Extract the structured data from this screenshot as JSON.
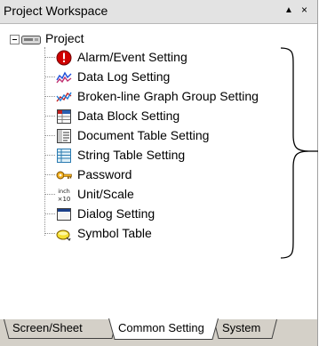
{
  "window": {
    "title": "Project Workspace",
    "pin_glyph": "▲",
    "close_glyph": "×"
  },
  "tree": {
    "root": {
      "label": "Project",
      "icon": "project-folder-icon"
    },
    "items": [
      {
        "label": "Alarm/Event Setting",
        "icon": "alarm-icon",
        "name": "alarm-event-setting"
      },
      {
        "label": "Data Log Setting",
        "icon": "data-log-icon",
        "name": "data-log-setting"
      },
      {
        "label": "Broken-line Graph Group Setting",
        "icon": "broken-line-graph-icon",
        "name": "broken-line-graph-group-setting"
      },
      {
        "label": "Data Block Setting",
        "icon": "data-block-icon",
        "name": "data-block-setting"
      },
      {
        "label": "Document Table Setting",
        "icon": "document-table-icon",
        "name": "document-table-setting"
      },
      {
        "label": "String Table Setting",
        "icon": "string-table-icon",
        "name": "string-table-setting"
      },
      {
        "label": "Password",
        "icon": "key-icon",
        "name": "password"
      },
      {
        "label": "Unit/Scale",
        "icon": "unit-scale-icon",
        "name": "unit-scale"
      },
      {
        "label": "Dialog Setting",
        "icon": "dialog-icon",
        "name": "dialog-setting"
      },
      {
        "label": "Symbol Table",
        "icon": "symbol-table-icon",
        "name": "symbol-table"
      }
    ]
  },
  "unit_icon_text": {
    "top": "inch",
    "bottom": "×10"
  },
  "tabs": [
    {
      "label": "Screen/Sheet",
      "active": false
    },
    {
      "label": "Common Setting",
      "active": true
    },
    {
      "label": "System",
      "active": false
    }
  ]
}
